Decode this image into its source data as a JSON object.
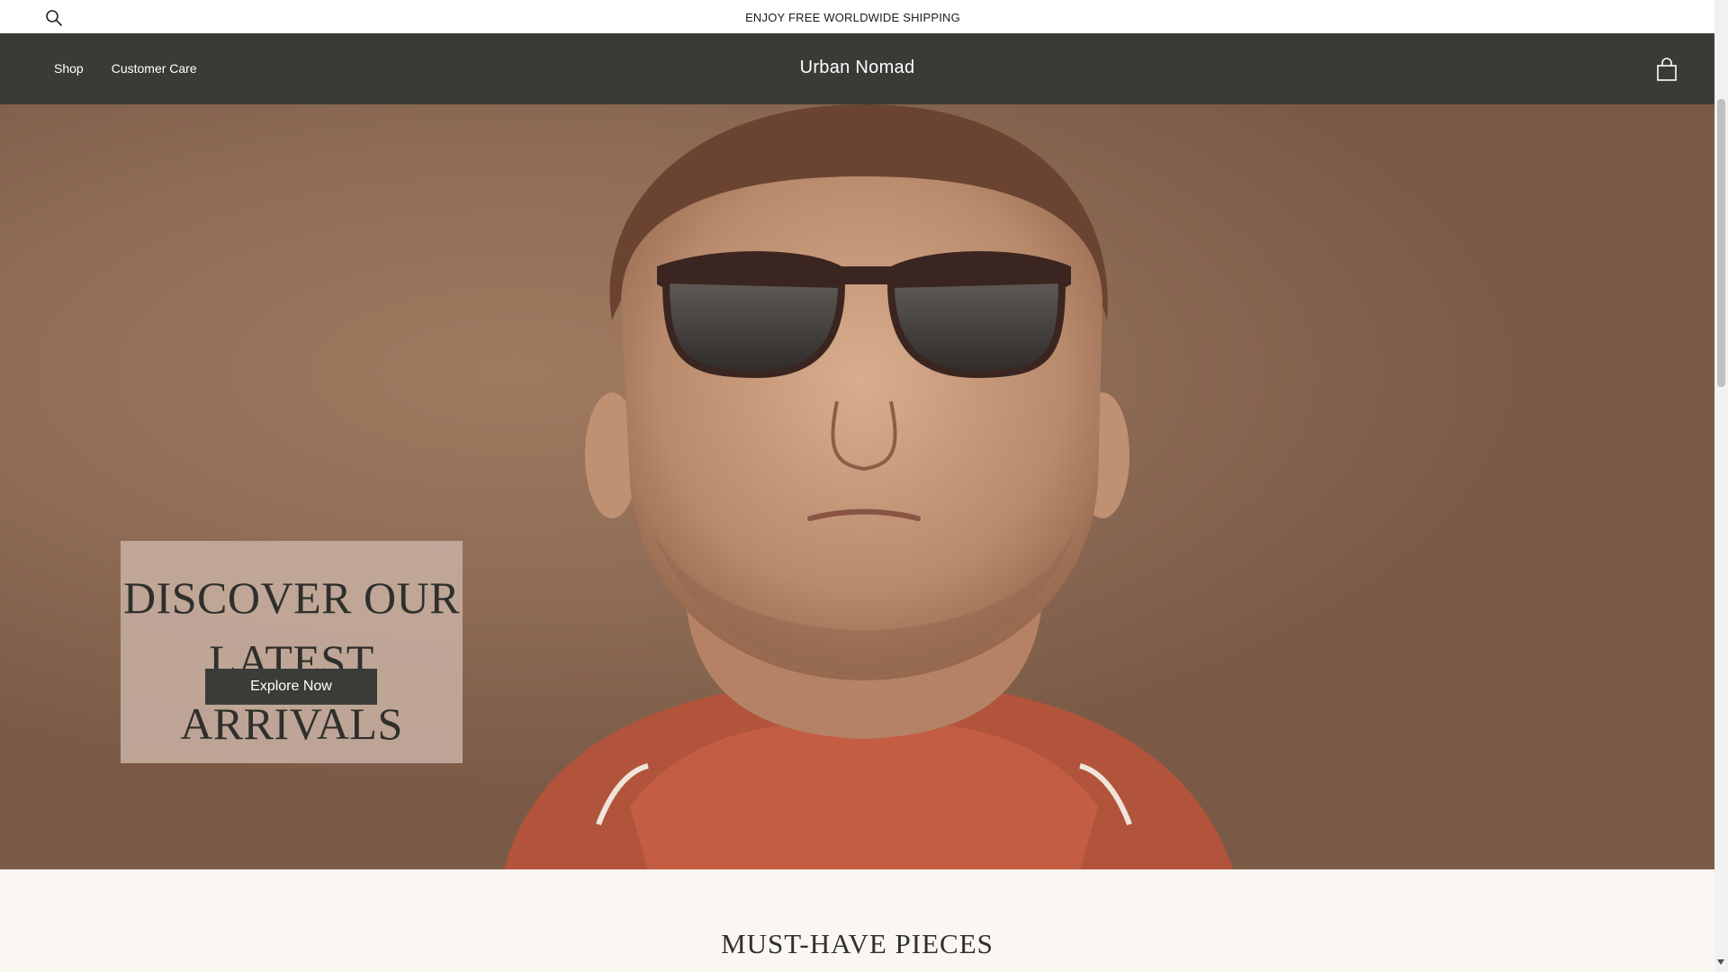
{
  "announcement": {
    "text": "ENJOY FREE WORLDWIDE SHIPPING"
  },
  "icons": {
    "search": "search-icon",
    "cart": "shopping-bag-icon"
  },
  "header": {
    "nav": [
      {
        "label": "Shop"
      },
      {
        "label": "Customer Care"
      }
    ],
    "brand": "Urban Nomad"
  },
  "hero": {
    "headline": "DISCOVER OUR LATEST ARRIVALS",
    "cta_label": "Explore Now"
  },
  "section": {
    "title": "MUST-HAVE PIECES"
  },
  "colors": {
    "header_bg": "#3a3a37",
    "hero_bg": "#8d6b55",
    "card_bg": "#c6aea0",
    "button_bg": "#3b3b38",
    "page_bg": "#faf7f2"
  }
}
